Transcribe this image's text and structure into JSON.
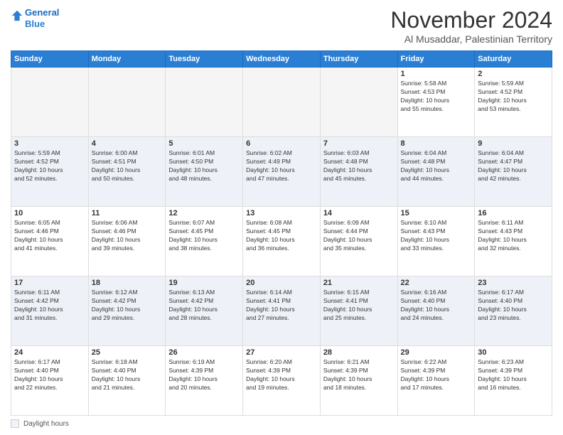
{
  "header": {
    "logo_line1": "General",
    "logo_line2": "Blue",
    "month": "November 2024",
    "location": "Al Musaddar, Palestinian Territory"
  },
  "weekdays": [
    "Sunday",
    "Monday",
    "Tuesday",
    "Wednesday",
    "Thursday",
    "Friday",
    "Saturday"
  ],
  "weeks": [
    [
      {
        "day": "",
        "info": ""
      },
      {
        "day": "",
        "info": ""
      },
      {
        "day": "",
        "info": ""
      },
      {
        "day": "",
        "info": ""
      },
      {
        "day": "",
        "info": ""
      },
      {
        "day": "1",
        "info": "Sunrise: 5:58 AM\nSunset: 4:53 PM\nDaylight: 10 hours\nand 55 minutes."
      },
      {
        "day": "2",
        "info": "Sunrise: 5:59 AM\nSunset: 4:52 PM\nDaylight: 10 hours\nand 53 minutes."
      }
    ],
    [
      {
        "day": "3",
        "info": "Sunrise: 5:59 AM\nSunset: 4:52 PM\nDaylight: 10 hours\nand 52 minutes."
      },
      {
        "day": "4",
        "info": "Sunrise: 6:00 AM\nSunset: 4:51 PM\nDaylight: 10 hours\nand 50 minutes."
      },
      {
        "day": "5",
        "info": "Sunrise: 6:01 AM\nSunset: 4:50 PM\nDaylight: 10 hours\nand 48 minutes."
      },
      {
        "day": "6",
        "info": "Sunrise: 6:02 AM\nSunset: 4:49 PM\nDaylight: 10 hours\nand 47 minutes."
      },
      {
        "day": "7",
        "info": "Sunrise: 6:03 AM\nSunset: 4:48 PM\nDaylight: 10 hours\nand 45 minutes."
      },
      {
        "day": "8",
        "info": "Sunrise: 6:04 AM\nSunset: 4:48 PM\nDaylight: 10 hours\nand 44 minutes."
      },
      {
        "day": "9",
        "info": "Sunrise: 6:04 AM\nSunset: 4:47 PM\nDaylight: 10 hours\nand 42 minutes."
      }
    ],
    [
      {
        "day": "10",
        "info": "Sunrise: 6:05 AM\nSunset: 4:46 PM\nDaylight: 10 hours\nand 41 minutes."
      },
      {
        "day": "11",
        "info": "Sunrise: 6:06 AM\nSunset: 4:46 PM\nDaylight: 10 hours\nand 39 minutes."
      },
      {
        "day": "12",
        "info": "Sunrise: 6:07 AM\nSunset: 4:45 PM\nDaylight: 10 hours\nand 38 minutes."
      },
      {
        "day": "13",
        "info": "Sunrise: 6:08 AM\nSunset: 4:45 PM\nDaylight: 10 hours\nand 36 minutes."
      },
      {
        "day": "14",
        "info": "Sunrise: 6:09 AM\nSunset: 4:44 PM\nDaylight: 10 hours\nand 35 minutes."
      },
      {
        "day": "15",
        "info": "Sunrise: 6:10 AM\nSunset: 4:43 PM\nDaylight: 10 hours\nand 33 minutes."
      },
      {
        "day": "16",
        "info": "Sunrise: 6:11 AM\nSunset: 4:43 PM\nDaylight: 10 hours\nand 32 minutes."
      }
    ],
    [
      {
        "day": "17",
        "info": "Sunrise: 6:11 AM\nSunset: 4:42 PM\nDaylight: 10 hours\nand 31 minutes."
      },
      {
        "day": "18",
        "info": "Sunrise: 6:12 AM\nSunset: 4:42 PM\nDaylight: 10 hours\nand 29 minutes."
      },
      {
        "day": "19",
        "info": "Sunrise: 6:13 AM\nSunset: 4:42 PM\nDaylight: 10 hours\nand 28 minutes."
      },
      {
        "day": "20",
        "info": "Sunrise: 6:14 AM\nSunset: 4:41 PM\nDaylight: 10 hours\nand 27 minutes."
      },
      {
        "day": "21",
        "info": "Sunrise: 6:15 AM\nSunset: 4:41 PM\nDaylight: 10 hours\nand 25 minutes."
      },
      {
        "day": "22",
        "info": "Sunrise: 6:16 AM\nSunset: 4:40 PM\nDaylight: 10 hours\nand 24 minutes."
      },
      {
        "day": "23",
        "info": "Sunrise: 6:17 AM\nSunset: 4:40 PM\nDaylight: 10 hours\nand 23 minutes."
      }
    ],
    [
      {
        "day": "24",
        "info": "Sunrise: 6:17 AM\nSunset: 4:40 PM\nDaylight: 10 hours\nand 22 minutes."
      },
      {
        "day": "25",
        "info": "Sunrise: 6:18 AM\nSunset: 4:40 PM\nDaylight: 10 hours\nand 21 minutes."
      },
      {
        "day": "26",
        "info": "Sunrise: 6:19 AM\nSunset: 4:39 PM\nDaylight: 10 hours\nand 20 minutes."
      },
      {
        "day": "27",
        "info": "Sunrise: 6:20 AM\nSunset: 4:39 PM\nDaylight: 10 hours\nand 19 minutes."
      },
      {
        "day": "28",
        "info": "Sunrise: 6:21 AM\nSunset: 4:39 PM\nDaylight: 10 hours\nand 18 minutes."
      },
      {
        "day": "29",
        "info": "Sunrise: 6:22 AM\nSunset: 4:39 PM\nDaylight: 10 hours\nand 17 minutes."
      },
      {
        "day": "30",
        "info": "Sunrise: 6:23 AM\nSunset: 4:39 PM\nDaylight: 10 hours\nand 16 minutes."
      }
    ]
  ],
  "footer": {
    "label": "Daylight hours"
  }
}
